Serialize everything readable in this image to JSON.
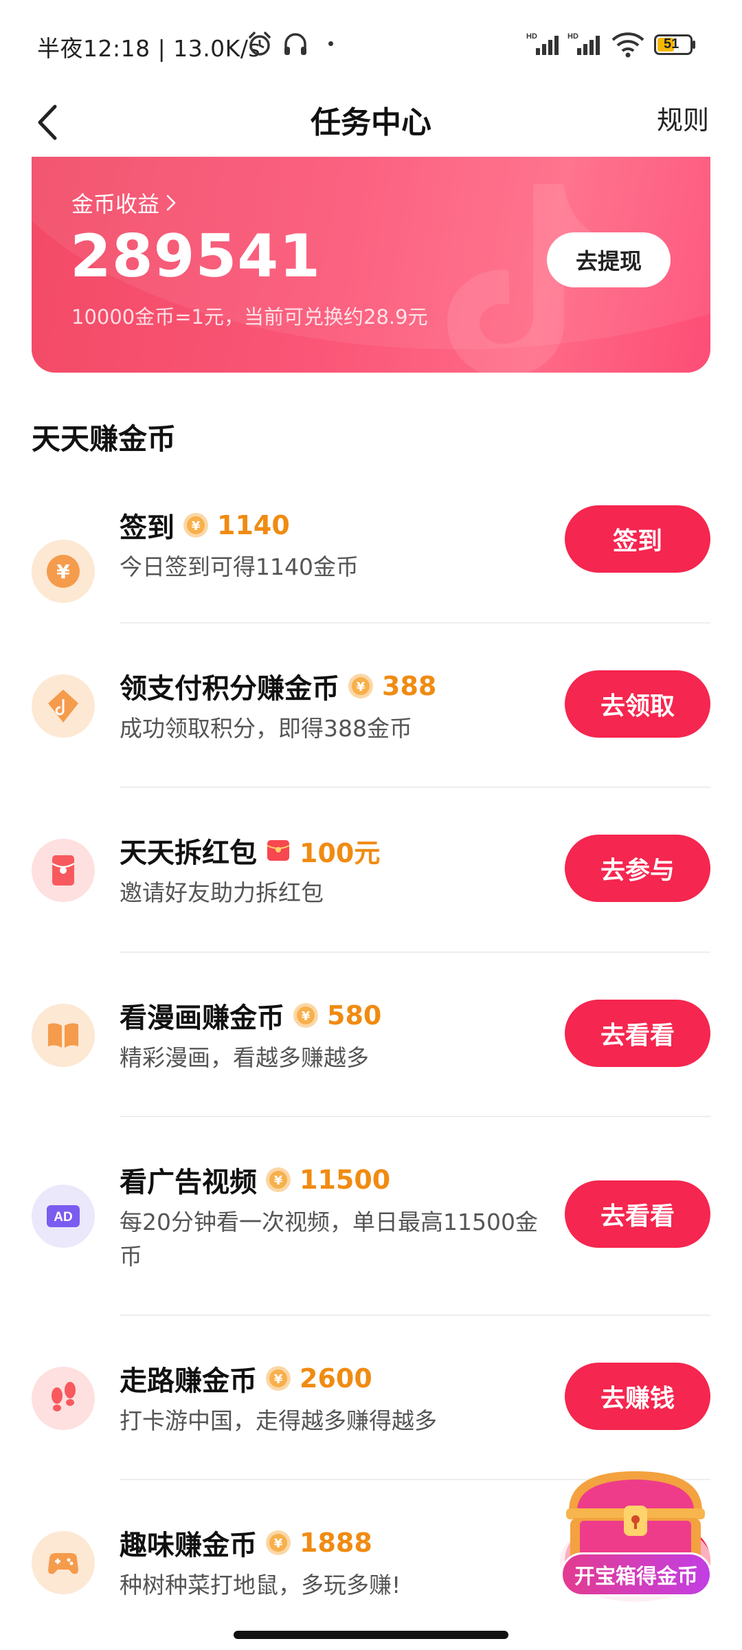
{
  "status_bar": {
    "text": "半夜12:18 | 13.0K/s",
    "battery": "51"
  },
  "nav": {
    "title": "任务中心",
    "rules": "规则"
  },
  "earnings": {
    "label": "金币收益",
    "amount": "289541",
    "rate_note": "10000金币=1元，当前可兑换约28.9元",
    "withdraw_label": "去提现"
  },
  "section_title": "天天赚金币",
  "tasks": [
    {
      "title": "签到",
      "reward": "1140",
      "reward_icon": "coin-icon",
      "desc": "今日签到可得1140金币",
      "button": "签到",
      "icon": "yuan-coin-icon",
      "icon_bg": "#fde8d4"
    },
    {
      "title": "领支付积分赚金币",
      "reward": "388",
      "reward_icon": "coin-icon",
      "desc": "成功领取积分，即得388金币",
      "button": "去领取",
      "icon": "diamond-tag-icon",
      "icon_bg": "#fde8d4"
    },
    {
      "title": "天天拆红包",
      "reward": "100元",
      "reward_icon": "red-envelope-icon",
      "desc": "邀请好友助力拆红包",
      "button": "去参与",
      "icon": "red-envelope-icon",
      "icon_bg": "#fde0df"
    },
    {
      "title": "看漫画赚金币",
      "reward": "580",
      "reward_icon": "coin-icon",
      "desc": "精彩漫画，看越多赚越多",
      "button": "去看看",
      "icon": "book-icon",
      "icon_bg": "#fde8d4"
    },
    {
      "title": "看广告视频",
      "reward": "11500",
      "reward_icon": "coin-icon",
      "desc": "每20分钟看一次视频，单日最高11500金币",
      "button": "去看看",
      "icon": "ad-icon",
      "icon_bg": "#ece8fb"
    },
    {
      "title": "走路赚金币",
      "reward": "2600",
      "reward_icon": "coin-icon",
      "desc": "打卡游中国，走得越多赚得越多",
      "button": "去赚钱",
      "icon": "footprints-icon",
      "icon_bg": "#fde0df"
    },
    {
      "title": "趣味赚金币",
      "reward": "1888",
      "reward_icon": "coin-icon",
      "desc": "种树种菜打地鼠，多玩多赚!",
      "button": "",
      "icon": "gamepad-icon",
      "icon_bg": "#fde8d4"
    }
  ],
  "treasure": {
    "label": "开宝箱得金币"
  },
  "colors": {
    "accent": "#f5264f",
    "reward": "#f08b12",
    "card_start": "#f24a66",
    "card_end": "#ff6a86"
  }
}
